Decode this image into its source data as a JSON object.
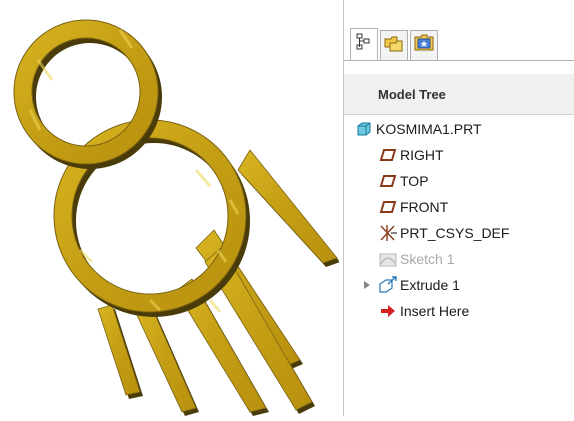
{
  "panel": {
    "tabs": [
      {
        "name": "model-tree-tab",
        "icon": "model-tree-icon"
      },
      {
        "name": "folder-browser-tab",
        "icon": "folder-icon"
      },
      {
        "name": "favorites-tab",
        "icon": "favorites-icon"
      }
    ],
    "header": "Model Tree"
  },
  "tree": {
    "items": [
      {
        "label": "KOSMIMA1.PRT",
        "icon": "part-icon"
      },
      {
        "label": "RIGHT",
        "icon": "datum-plane-icon"
      },
      {
        "label": "TOP",
        "icon": "datum-plane-icon"
      },
      {
        "label": "FRONT",
        "icon": "datum-plane-icon"
      },
      {
        "label": "PRT_CSYS_DEF",
        "icon": "csys-icon"
      },
      {
        "label": "Sketch 1",
        "icon": "sketch-icon"
      },
      {
        "label": "Extrude 1",
        "icon": "extrude-icon"
      },
      {
        "label": "Insert Here",
        "icon": "insert-arrow-icon"
      }
    ]
  },
  "colors": {
    "model": "#c9a61a",
    "model_edge": "#5a4a0e",
    "model_highlight": "#e8cf4a",
    "datum": "#8a3a1a",
    "part": "#2ea6c9",
    "insert": "#d42020"
  }
}
